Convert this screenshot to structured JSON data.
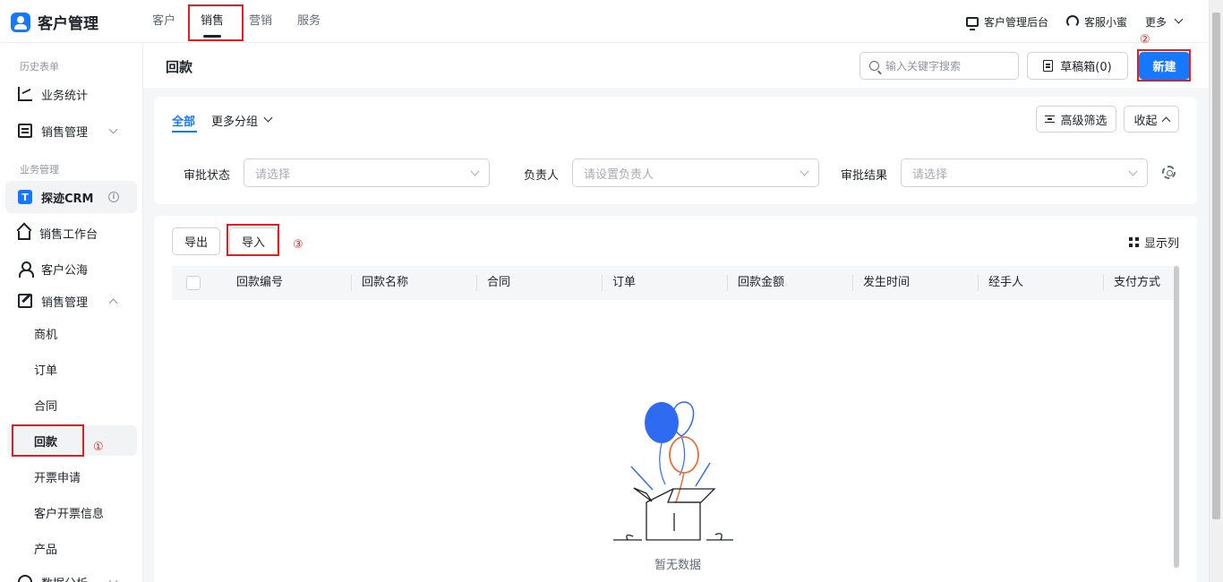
{
  "app": {
    "name": "客户管理"
  },
  "nav": {
    "tabs": [
      "客户",
      "销售",
      "营销",
      "服务"
    ],
    "active": "销售"
  },
  "topbar": {
    "admin": "客户管理后台",
    "support": "客服小蜜",
    "more": "更多"
  },
  "sidebar": {
    "section_history": "历史表单",
    "biz_stats": "业务统计",
    "sales_mgmt_1": "销售管理",
    "section_biz": "业务管理",
    "crm_name": "探迹CRM",
    "crm_badge": "T",
    "workbench": "销售工作台",
    "public_pool": "客户公海",
    "sales_mgmt_2": "销售管理",
    "sub_items": [
      "商机",
      "订单",
      "合同",
      "回款",
      "开票申请",
      "客户开票信息",
      "产品"
    ],
    "data_analysis": "数据分析"
  },
  "header": {
    "title": "回款",
    "search_placeholder": "输入关键字搜索",
    "draft": "草稿箱(0)",
    "new_button": "新建"
  },
  "filters": {
    "tab_all": "全部",
    "tab_more": "更多分组",
    "advanced": "高级筛选",
    "collapse": "收起",
    "fields": [
      {
        "label": "审批状态",
        "placeholder": "请选择"
      },
      {
        "label": "负责人",
        "placeholder": "请设置负责人"
      },
      {
        "label": "审批结果",
        "placeholder": "请选择"
      }
    ]
  },
  "table": {
    "export": "导出",
    "import": "导入",
    "show_columns": "显示列",
    "columns": [
      "回款编号",
      "回款名称",
      "合同",
      "订单",
      "回款金额",
      "发生时间",
      "经手人",
      "支付方式"
    ],
    "empty": "暂无数据"
  },
  "annotations": {
    "one": "①",
    "two": "②",
    "three": "③"
  },
  "colors": {
    "primary": "#1677ff",
    "highlight": "#e02020",
    "balloon_blue": "#2f6bf0",
    "balloon_orange": "#f26b3a"
  }
}
